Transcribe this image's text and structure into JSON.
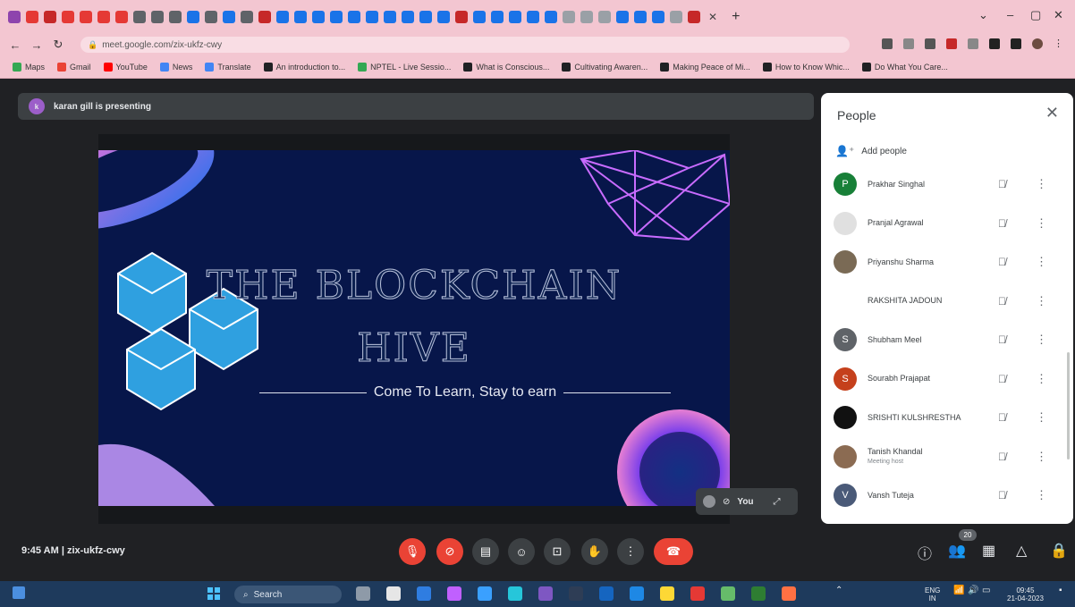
{
  "browser": {
    "url": "meet.google.com/zix-ukfz-cwy",
    "tab_favicon_colors": [
      "#8e44ad",
      "#e53935",
      "#c62828",
      "#e53935",
      "#e53935",
      "#e53935",
      "#e53935",
      "#5f6368",
      "#5f6368",
      "#5f6368",
      "#1a73e8",
      "#5f6368",
      "#1a73e8",
      "#5f6368",
      "#c62828",
      "#1a73e8",
      "#1a73e8",
      "#1a73e8",
      "#1a73e8",
      "#1a73e8",
      "#1a73e8",
      "#1a73e8",
      "#1a73e8",
      "#1a73e8",
      "#1a73e8",
      "#c62828",
      "#1a73e8",
      "#1a73e8",
      "#1a73e8",
      "#1a73e8",
      "#1a73e8",
      "#9aa0a6",
      "#9aa0a6",
      "#9aa0a6",
      "#1a73e8",
      "#1a73e8",
      "#1a73e8",
      "#9aa0a6",
      "#c62828"
    ],
    "bookmarks": [
      {
        "label": "Maps",
        "color": "#34a853"
      },
      {
        "label": "Gmail",
        "color": "#ea4335"
      },
      {
        "label": "YouTube",
        "color": "#ff0000"
      },
      {
        "label": "News",
        "color": "#4285f4"
      },
      {
        "label": "Translate",
        "color": "#4285f4"
      },
      {
        "label": "An introduction to...",
        "color": "#202124"
      },
      {
        "label": "NPTEL - Live Sessio...",
        "color": "#34a853"
      },
      {
        "label": "What is Conscious...",
        "color": "#202124"
      },
      {
        "label": "Cultivating Awaren...",
        "color": "#202124"
      },
      {
        "label": "Making Peace of Mi...",
        "color": "#202124"
      },
      {
        "label": "How to Know Whic...",
        "color": "#202124"
      },
      {
        "label": "Do What You Care...",
        "color": "#202124"
      }
    ]
  },
  "meet": {
    "presenting_label": "karan gill is presenting",
    "presenter_initial": "k",
    "slide": {
      "title_line1": "THE BLOCKCHAIN",
      "title_line2": "HIVE",
      "subtitle": "Come To Learn, Stay to earn"
    },
    "self_tile_label": "You",
    "time_code": "9:45 AM  |  zix-ukfz-cwy",
    "participant_count": "20"
  },
  "people_panel": {
    "title": "People",
    "add_people_label": "Add people",
    "participants": [
      {
        "name": "Prakhar Singhal",
        "initial": "P",
        "avatar_color": "#188038",
        "role": ""
      },
      {
        "name": "Pranjal Agrawal",
        "initial": "",
        "avatar_color": "#e0e0e0",
        "role": ""
      },
      {
        "name": "Priyanshu Sharma",
        "initial": "",
        "avatar_color": "#7a6a55",
        "role": ""
      },
      {
        "name": "RAKSHITA JADOUN",
        "initial": "",
        "avatar_color": "#ffffff",
        "role": ""
      },
      {
        "name": "Shubham Meel",
        "initial": "S",
        "avatar_color": "#5f6368",
        "role": ""
      },
      {
        "name": "Sourabh Prajapat",
        "initial": "S",
        "avatar_color": "#c5401c",
        "role": ""
      },
      {
        "name": "SRISHTI KULSHRESTHA",
        "initial": "",
        "avatar_color": "#111111",
        "role": ""
      },
      {
        "name": "Tanish Khandal",
        "initial": "",
        "avatar_color": "#8b6b52",
        "role": "Meeting host"
      },
      {
        "name": "Vansh Tuteja",
        "initial": "V",
        "avatar_color": "#4a5a78",
        "role": ""
      }
    ]
  },
  "taskbar": {
    "search_label": "Search",
    "lang_line1": "ENG",
    "lang_line2": "IN",
    "clock_time": "09:45",
    "clock_date": "21-04-2023"
  }
}
